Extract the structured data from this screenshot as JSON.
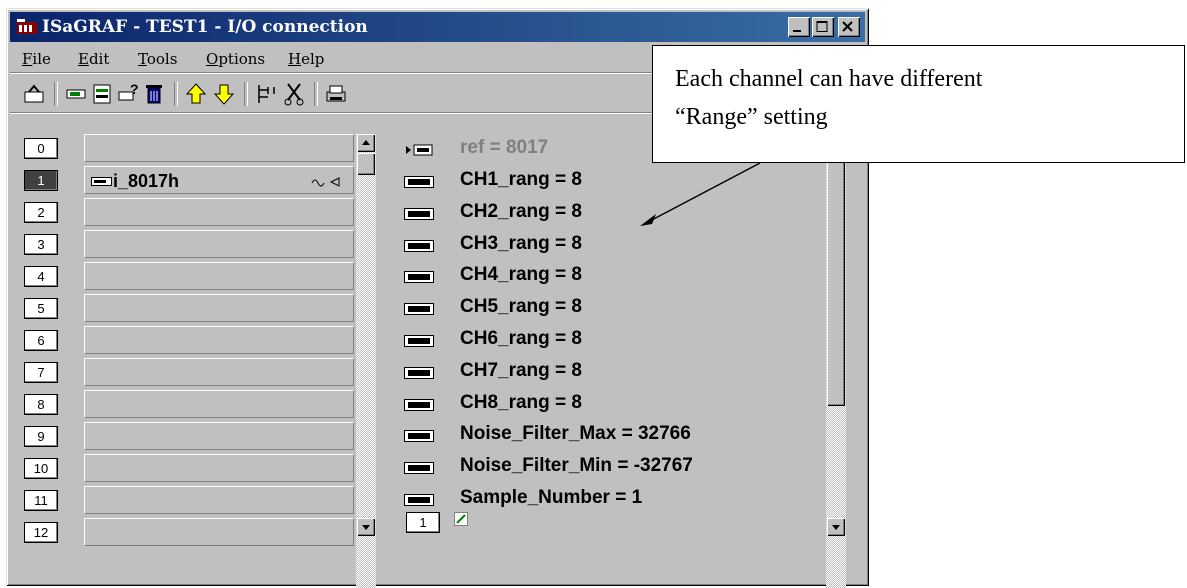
{
  "window": {
    "title": "ISaGRAF - TEST1 - I/O connection"
  },
  "menu": [
    {
      "label": "File",
      "mnemonic": "F",
      "rest": "ile"
    },
    {
      "label": "Edit",
      "mnemonic": "E",
      "rest": "dit"
    },
    {
      "label": "Tools",
      "mnemonic": "T",
      "rest": "ools"
    },
    {
      "label": "Options",
      "mnemonic": "O",
      "rest": "ptions"
    },
    {
      "label": "Help",
      "mnemonic": "H",
      "rest": "elp"
    }
  ],
  "toolbar_icons": [
    "open-icon",
    "connect-board-icon",
    "board-params-icon",
    "help-board-icon",
    "trash-icon",
    "arrow-up-icon",
    "arrow-down-icon",
    "tree-icon",
    "cut-icon",
    "print-icon"
  ],
  "slots": [
    {
      "num": "0",
      "name": ""
    },
    {
      "num": "1",
      "name": "i_8017h",
      "active": true
    },
    {
      "num": "2",
      "name": ""
    },
    {
      "num": "3",
      "name": ""
    },
    {
      "num": "4",
      "name": ""
    },
    {
      "num": "5",
      "name": ""
    },
    {
      "num": "6",
      "name": ""
    },
    {
      "num": "7",
      "name": ""
    },
    {
      "num": "8",
      "name": ""
    },
    {
      "num": "9",
      "name": ""
    },
    {
      "num": "10",
      "name": ""
    },
    {
      "num": "11",
      "name": ""
    },
    {
      "num": "12",
      "name": ""
    }
  ],
  "params": {
    "ref": "ref = 8017",
    "rows": [
      "CH1_rang = 8",
      "CH2_rang = 8",
      "CH3_rang = 8",
      "CH4_rang = 8",
      "CH5_rang = 8",
      "CH6_rang = 8",
      "CH7_rang = 8",
      "CH8_rang = 8",
      "Noise_Filter_Max = 32766",
      "Noise_Filter_Min = -32767",
      "Sample_Number = 1"
    ],
    "channel_num": "1"
  },
  "callout": {
    "line1": "Each channel can have different",
    "line2": "“Range” setting"
  },
  "colors": {
    "title_bar": "#0a246a",
    "window_bg": "#c0c0c0",
    "arrow_up": "#ffff00"
  }
}
